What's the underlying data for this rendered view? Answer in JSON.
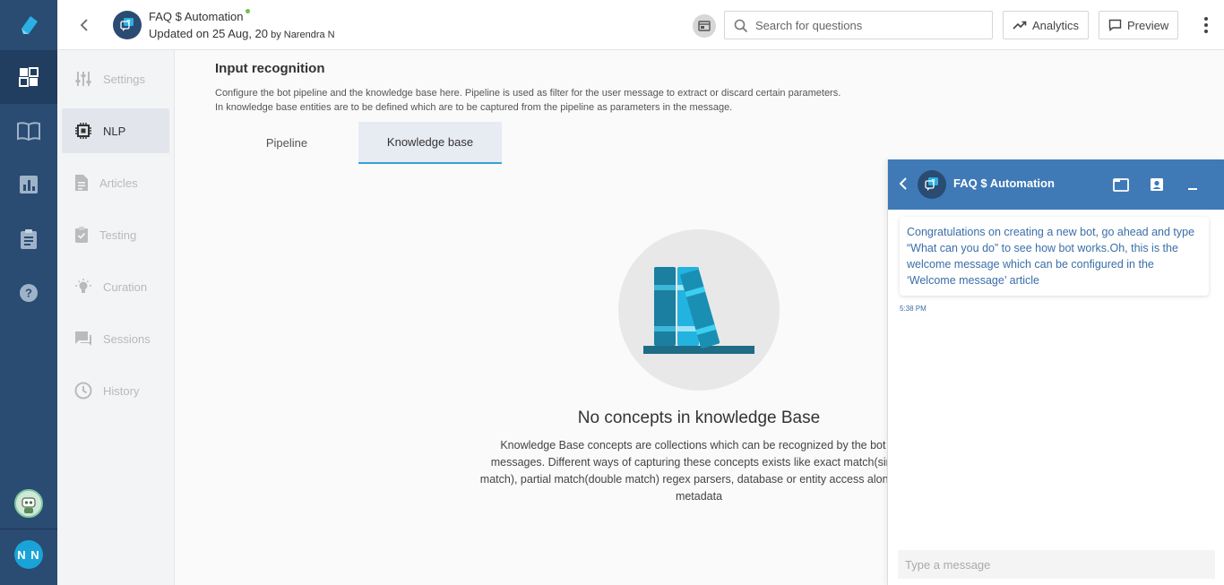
{
  "header": {
    "bot_name": "FAQ $ Automation",
    "updated_prefix": "Updated on 25 Aug, 20",
    "updated_by": " by Narendra N",
    "search_placeholder": "Search for questions",
    "analytics_label": "Analytics",
    "preview_label": "Preview",
    "status_color": "#6cc24a"
  },
  "rail": {
    "items": [
      {
        "icon": "dashboard-icon",
        "active": true
      },
      {
        "icon": "book-icon",
        "active": false
      },
      {
        "icon": "bar-chart-icon",
        "active": false
      },
      {
        "icon": "clipboard-icon",
        "active": false
      },
      {
        "icon": "help-icon",
        "active": false
      }
    ],
    "user_initials": "N N",
    "accent": "#2a4b72"
  },
  "subnav": {
    "items": [
      {
        "label": "Settings",
        "icon": "sliders-icon"
      },
      {
        "label": "NLP",
        "icon": "chip-icon"
      },
      {
        "label": "Articles",
        "icon": "document-icon"
      },
      {
        "label": "Testing",
        "icon": "clipboard-check-icon"
      },
      {
        "label": "Curation",
        "icon": "lightbulb-icon"
      },
      {
        "label": "Sessions",
        "icon": "chat-icon"
      },
      {
        "label": "History",
        "icon": "history-icon"
      }
    ],
    "active_label": "NLP"
  },
  "main": {
    "title": "Input recognition",
    "desc_line1": "Configure the bot pipeline and the knowledge base here. Pipeline is used as filter for the user message to extract or discard certain parameters.",
    "desc_line2": "In knowledge base entities are to be defined which are to be captured from the pipeline as parameters in the message.",
    "tabs": [
      {
        "label": "Pipeline"
      },
      {
        "label": "Knowledge base"
      }
    ],
    "active_tab": "Knowledge base",
    "empty_title": "No concepts in knowledge Base",
    "empty_desc": "Knowledge Base concepts are collections which can be recognized by the bot in messages. Different ways of capturing these concepts exists like exact match(single match), partial match(double match) regex parsers, database or entity access along with metadata"
  },
  "chat": {
    "title": "FAQ $ Automation",
    "message": "Congratulations on creating a new bot, go ahead and type “What can you do” to see how bot works.Oh, this is the welcome message which can be configured in the ‘Welcome message’ article",
    "time": "5:38 PM",
    "input_placeholder": "Type a message",
    "header_color": "#3f7ab7"
  }
}
